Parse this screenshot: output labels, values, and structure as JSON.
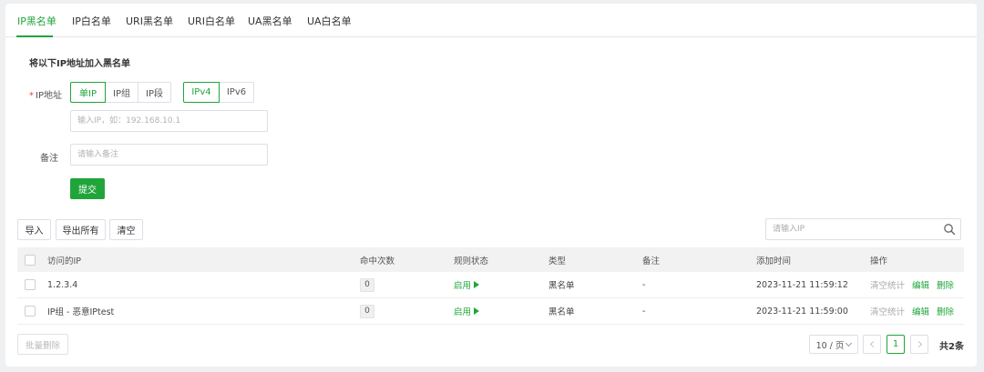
{
  "tabs": [
    {
      "label": "IP黑名单",
      "active": true
    },
    {
      "label": "IP白名单",
      "active": false
    },
    {
      "label": "URI黑名单",
      "active": false
    },
    {
      "label": "URI白名单",
      "active": false
    },
    {
      "label": "UA黑名单",
      "active": false
    },
    {
      "label": "UA白名单",
      "active": false
    }
  ],
  "form": {
    "section_title": "将以下IP地址加入黑名单",
    "ip_label": "IP地址",
    "required_mark": "*",
    "ip_type_options": [
      "单IP",
      "IP组",
      "IP段"
    ],
    "ip_type_selected": "单IP",
    "ip_version_options": [
      "IPv4",
      "IPv6"
    ],
    "ip_version_selected": "IPv4",
    "ip_placeholder": "输入IP，如：192.168.10.1",
    "ip_value": "",
    "remark_label": "备注",
    "remark_placeholder": "请输入备注",
    "remark_value": "",
    "submit_label": "提交"
  },
  "toolbar": {
    "import_label": "导入",
    "export_label": "导出所有",
    "clear_label": "清空",
    "search_placeholder": "请输入IP",
    "search_icon": "search-icon"
  },
  "table": {
    "columns": [
      "访问的IP",
      "命中次数",
      "规则状态",
      "类型",
      "备注",
      "添加时间",
      "操作"
    ],
    "rows": [
      {
        "ip": "1.2.3.4",
        "hits": "0",
        "status": "启用",
        "type": "黑名单",
        "remark": "-",
        "added": "2023-11-21 11:59:12"
      },
      {
        "ip": "IP组 - 恶意IPtest",
        "hits": "0",
        "status": "启用",
        "type": "黑名单",
        "remark": "-",
        "added": "2023-11-21 11:59:00"
      }
    ],
    "actions": [
      "清空统计",
      "编辑",
      "删除"
    ]
  },
  "footer": {
    "bulk_delete_label": "批量删除",
    "page_size_label": "10 / 页",
    "current_page": "1",
    "total_label": "共2条"
  },
  "colors": {
    "accent": "#20a53a",
    "required": "#e64545",
    "header_bg": "#f2f2f2"
  }
}
